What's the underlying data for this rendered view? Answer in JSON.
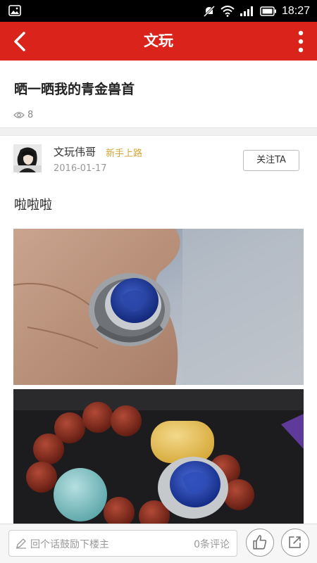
{
  "status_bar": {
    "time": "18:27",
    "icons": [
      "image-notification-icon",
      "mute-icon",
      "wifi-icon",
      "signal-icon",
      "battery-icon"
    ]
  },
  "header": {
    "title": "文玩",
    "back_icon": "chevron-left-icon",
    "more_icon": "more-vertical-icon",
    "color": "#d9231b"
  },
  "post": {
    "title": "晒一晒我的青金兽首",
    "views": "8",
    "author": {
      "name": "文玩伟哥",
      "badge": "新手上路",
      "date": "2016-01-17",
      "follow_label": "关注TA"
    },
    "body": "啦啦啦",
    "photos": [
      {
        "subject": "silver ring with carved lapis lazuli beast head on hand"
      },
      {
        "subject": "rudraksha bracelet with turquoise, amber bead and lapis ring"
      }
    ]
  },
  "bottom_bar": {
    "comment_placeholder": "回个话鼓励下楼主",
    "comment_count": "0条评论",
    "like_icon": "thumbs-up-icon",
    "share_icon": "share-icon"
  }
}
